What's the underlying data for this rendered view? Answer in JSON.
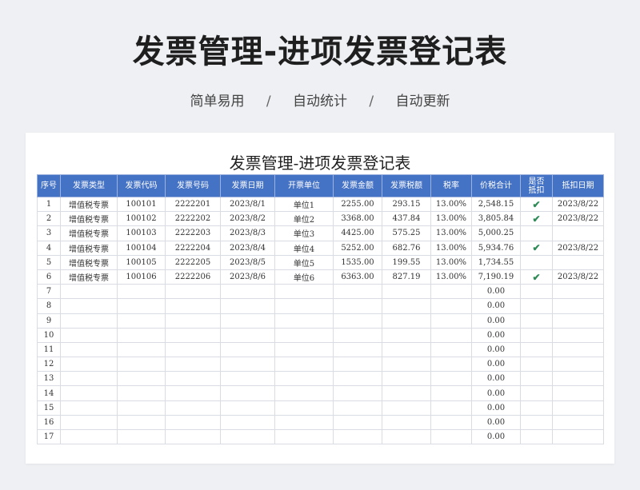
{
  "page": {
    "hero_title": "发票管理-进项发票登记表",
    "tagline": [
      "简单易用",
      "自动统计",
      "自动更新"
    ],
    "separator": "/"
  },
  "sheet": {
    "title": "发票管理-进项发票登记表",
    "headers": [
      "序号",
      "发票类型",
      "发票代码",
      "发票号码",
      "发票日期",
      "开票单位",
      "发票金额",
      "发票税额",
      "税率",
      "价税合计",
      "是否\n抵扣",
      "抵扣日期"
    ],
    "rows": [
      [
        "1",
        "增值税专票",
        "100101",
        "2222201",
        "2023/8/1",
        "单位1",
        "2255.00",
        "293.15",
        "13.00%",
        "2,548.15",
        "check",
        "2023/8/22"
      ],
      [
        "2",
        "增值税专票",
        "100102",
        "2222202",
        "2023/8/2",
        "单位2",
        "3368.00",
        "437.84",
        "13.00%",
        "3,805.84",
        "check",
        "2023/8/22"
      ],
      [
        "3",
        "增值税专票",
        "100103",
        "2222203",
        "2023/8/3",
        "单位3",
        "4425.00",
        "575.25",
        "13.00%",
        "5,000.25",
        "",
        ""
      ],
      [
        "4",
        "增值税专票",
        "100104",
        "2222204",
        "2023/8/4",
        "单位4",
        "5252.00",
        "682.76",
        "13.00%",
        "5,934.76",
        "check",
        "2023/8/22"
      ],
      [
        "5",
        "增值税专票",
        "100105",
        "2222205",
        "2023/8/5",
        "单位5",
        "1535.00",
        "199.55",
        "13.00%",
        "1,734.55",
        "",
        ""
      ],
      [
        "6",
        "增值税专票",
        "100106",
        "2222206",
        "2023/8/6",
        "单位6",
        "6363.00",
        "827.19",
        "13.00%",
        "7,190.19",
        "check",
        "2023/8/22"
      ],
      [
        "7",
        "",
        "",
        "",
        "",
        "",
        "",
        "",
        "",
        "0.00",
        "",
        ""
      ],
      [
        "8",
        "",
        "",
        "",
        "",
        "",
        "",
        "",
        "",
        "0.00",
        "",
        ""
      ],
      [
        "9",
        "",
        "",
        "",
        "",
        "",
        "",
        "",
        "",
        "0.00",
        "",
        ""
      ],
      [
        "10",
        "",
        "",
        "",
        "",
        "",
        "",
        "",
        "",
        "0.00",
        "",
        ""
      ],
      [
        "11",
        "",
        "",
        "",
        "",
        "",
        "",
        "",
        "",
        "0.00",
        "",
        ""
      ],
      [
        "12",
        "",
        "",
        "",
        "",
        "",
        "",
        "",
        "",
        "0.00",
        "",
        ""
      ],
      [
        "13",
        "",
        "",
        "",
        "",
        "",
        "",
        "",
        "",
        "0.00",
        "",
        ""
      ],
      [
        "14",
        "",
        "",
        "",
        "",
        "",
        "",
        "",
        "",
        "0.00",
        "",
        ""
      ],
      [
        "15",
        "",
        "",
        "",
        "",
        "",
        "",
        "",
        "",
        "0.00",
        "",
        ""
      ],
      [
        "16",
        "",
        "",
        "",
        "",
        "",
        "",
        "",
        "",
        "0.00",
        "",
        ""
      ],
      [
        "17",
        "",
        "",
        "",
        "",
        "",
        "",
        "",
        "",
        "0.00",
        "",
        ""
      ]
    ]
  },
  "colors": {
    "header_bg": "#4472c4",
    "check_color": "#2e8b57",
    "page_bg": "#eef0f3"
  },
  "icons": {
    "deducted": "checkmark-icon"
  }
}
